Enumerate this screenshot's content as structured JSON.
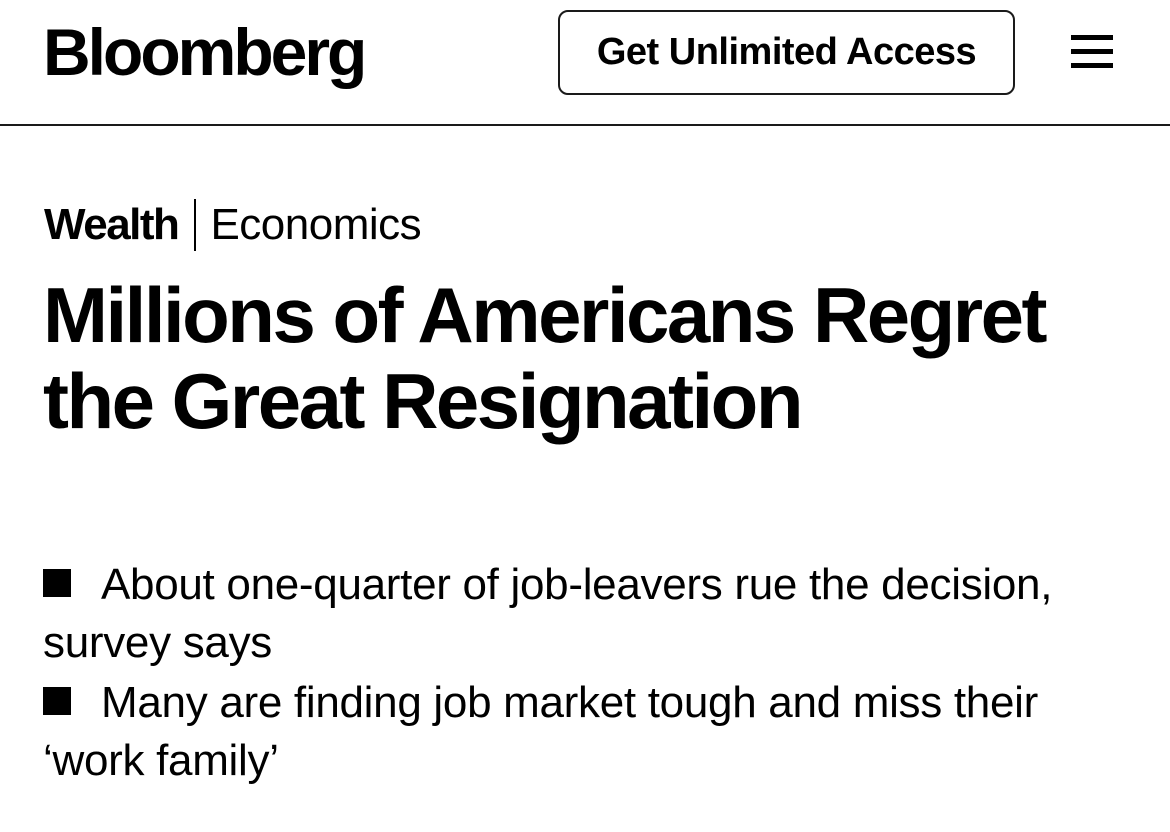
{
  "header": {
    "logo": "Bloomberg",
    "cta_label": "Get Unlimited Access",
    "menu_icon": "hamburger-menu-icon"
  },
  "article": {
    "section": "Wealth",
    "subsection": "Economics",
    "headline": "Millions of Americans Regret the Great Resignation",
    "bullets": [
      {
        "icon": "square-bullet-icon",
        "text": "About one-quarter of job-leavers rue the decision, survey says"
      },
      {
        "icon": "square-bullet-icon",
        "text": "Many are finding job market tough and miss their ‘work family’"
      }
    ]
  }
}
